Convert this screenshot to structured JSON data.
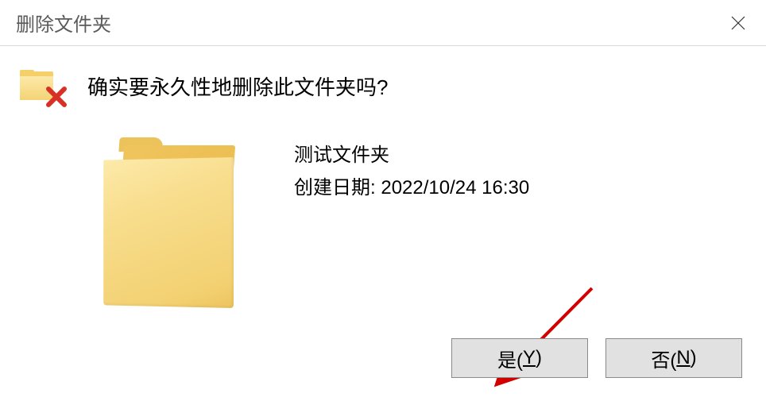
{
  "dialog": {
    "title": "删除文件夹",
    "question": "确实要永久性地删除此文件夹吗?",
    "folder_name": "测试文件夹",
    "date_label": "创建日期: ",
    "date_value": "2022/10/24 16:30",
    "yes_prefix": "是(",
    "yes_mnemonic": "Y",
    "yes_suffix": ")",
    "no_prefix": "否(",
    "no_mnemonic": "N",
    "no_suffix": ")"
  }
}
